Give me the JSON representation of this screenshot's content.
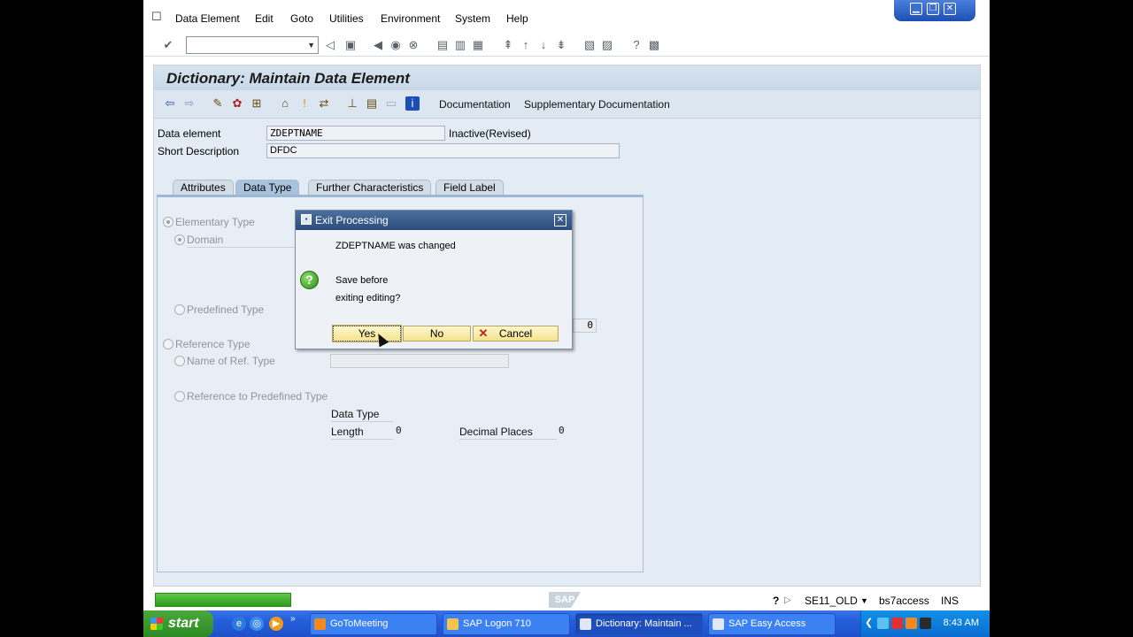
{
  "menu": {
    "items": [
      "Data Element",
      "Edit",
      "Goto",
      "Utilities",
      "Environment",
      "System",
      "Help"
    ]
  },
  "window_controls": {
    "minimize": "▁",
    "restore": "❐",
    "close": "✕"
  },
  "page": {
    "title": "Dictionary: Maintain Data Element"
  },
  "app_toolbar": {
    "documentation": "Documentation",
    "supplementary": "Supplementary Documentation"
  },
  "header": {
    "data_element_label": "Data element",
    "data_element_value": "ZDEPTNAME",
    "status": "Inactive(Revised)",
    "short_desc_label": "Short Description",
    "short_desc_value": "DFDC"
  },
  "tabs": [
    {
      "label": "Attributes",
      "active": false
    },
    {
      "label": "Data Type",
      "active": true
    },
    {
      "label": "Further Characteristics",
      "active": false
    },
    {
      "label": "Field Label",
      "active": false
    }
  ],
  "data_type_tab": {
    "elementary_type": "Elementary Type",
    "domain": "Domain",
    "predefined_type": "Predefined Type",
    "predefined_value": "0",
    "reference_type": "Reference Type",
    "name_of_ref_type": "Name of Ref. Type",
    "ref_to_predefined": "Reference to Predefined Type",
    "data_type_label": "Data Type",
    "length_label": "Length",
    "length_value": "0",
    "decimal_places_label": "Decimal Places",
    "decimal_places_value": "0"
  },
  "dialog": {
    "title": "Exit Processing",
    "message": "ZDEPTNAME was changed",
    "question_line1": "Save before",
    "question_line2": "exiting editing?",
    "yes": "Yes",
    "no": "No",
    "cancel": "Cancel"
  },
  "status_bar": {
    "sap_logo": "SAP",
    "transaction": "SE11_OLD",
    "server": "bs7access",
    "mode": "INS"
  },
  "taskbar": {
    "start": "start",
    "tasks": [
      {
        "label": "GoToMeeting",
        "active": false
      },
      {
        "label": "SAP Logon 710",
        "active": false
      },
      {
        "label": "Dictionary: Maintain ...",
        "active": true
      },
      {
        "label": "SAP Easy Access",
        "active": false
      }
    ],
    "clock": "8:43 AM"
  }
}
